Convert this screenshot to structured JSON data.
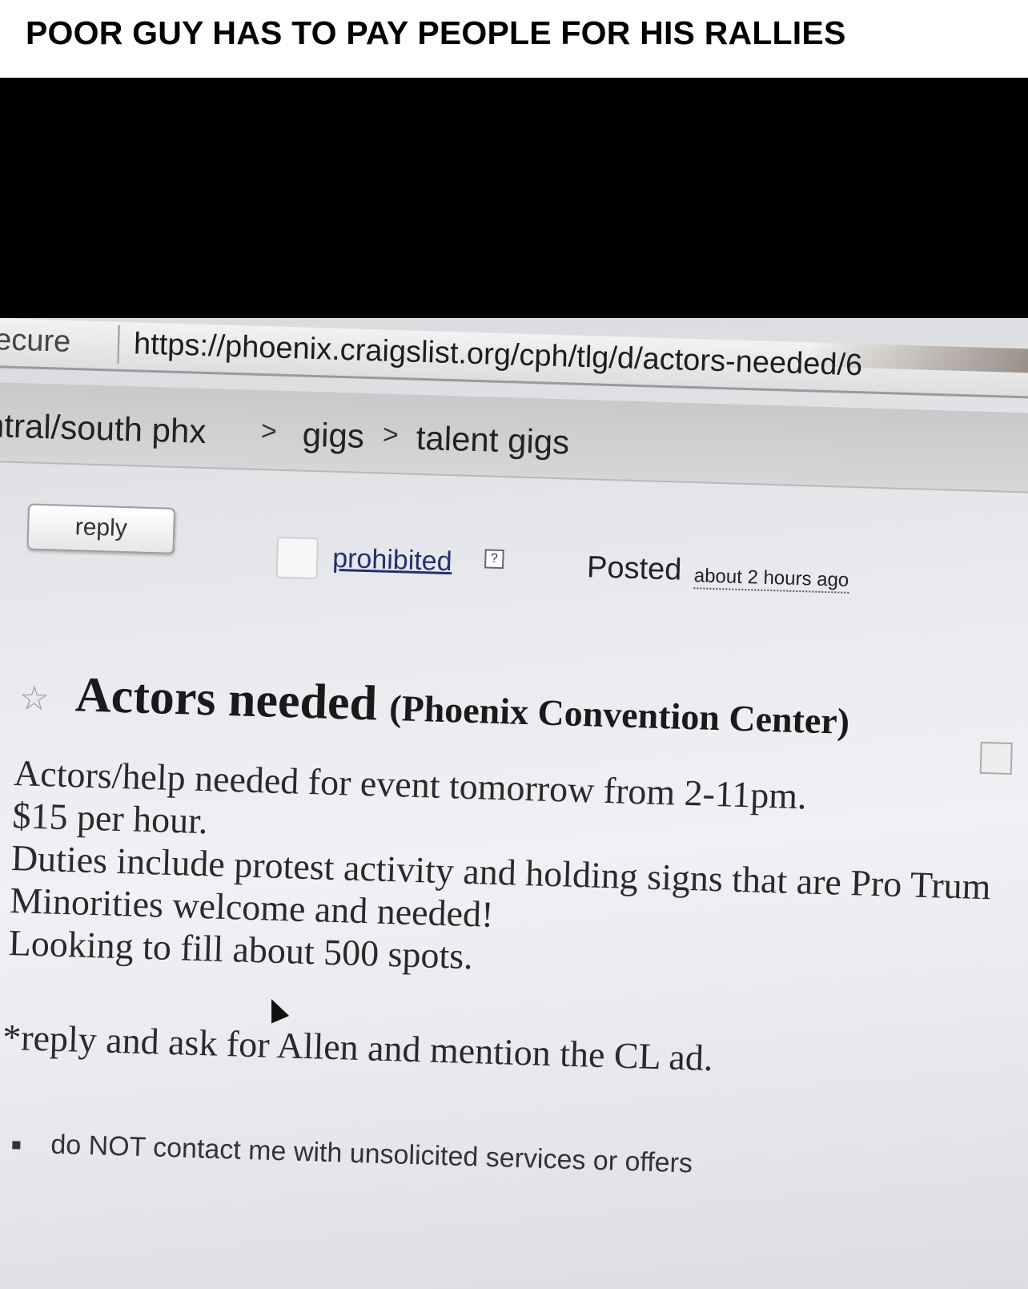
{
  "caption": {
    "text": "POOR GUY HAS TO PAY PEOPLE FOR HIS RALLIES"
  },
  "browser": {
    "secure_label": "ecure",
    "url": "https://phoenix.craigslist.org/cph/tlg/d/actors-needed/6"
  },
  "breadcrumb": {
    "items": [
      "ntral/south phx",
      "gigs",
      "talent gigs"
    ],
    "separator": ">"
  },
  "controls": {
    "reply_label": "reply",
    "prohibited_label": "prohibited",
    "help_label": "?",
    "posted_label": "Posted",
    "posted_time": "about 2 hours ago"
  },
  "post": {
    "title": "Actors needed",
    "location": "(Phoenix Convention Center)",
    "body_lines": [
      "Actors/help needed for event tomorrow from 2-11pm.",
      "$15 per hour.",
      "Duties include protest activity and holding signs that are Pro Trum",
      "Minorities welcome and needed!",
      "Looking to fill about 500 spots."
    ],
    "contact": "*reply and ask for Allen and mention the CL ad.",
    "notices": [
      "do NOT contact me with unsolicited services or offers"
    ]
  },
  "icons": {
    "star": "star-icon",
    "cursor": "cursor-icon",
    "hide": "hide-posting-icon"
  }
}
